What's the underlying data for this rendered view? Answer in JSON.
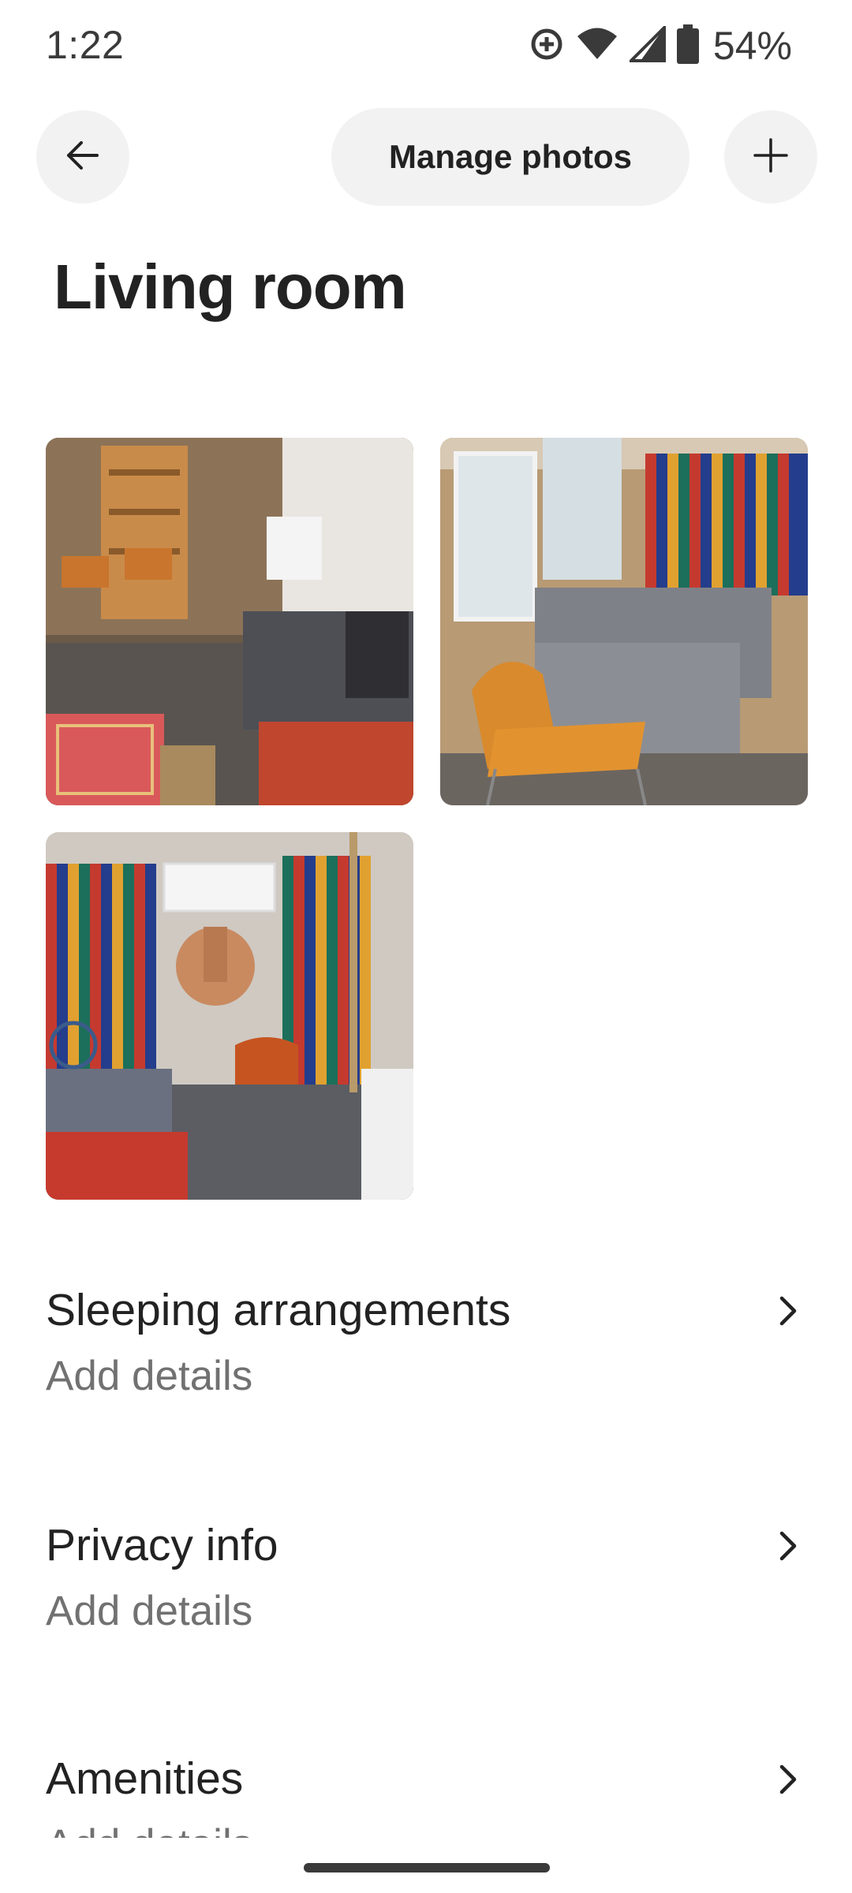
{
  "status_bar": {
    "time": "1:22",
    "battery": "54%",
    "icons": [
      "data-saver-icon",
      "wifi-icon",
      "signal-icon",
      "battery-icon"
    ]
  },
  "top_bar": {
    "back_icon": "arrow-left-icon",
    "manage_label": "Manage photos",
    "add_icon": "plus-icon"
  },
  "page": {
    "title": "Living room"
  },
  "photos": [
    {
      "description_icon": "living-room-photo"
    },
    {
      "description_icon": "living-room-photo"
    },
    {
      "description_icon": "living-room-photo"
    }
  ],
  "sections": [
    {
      "title": "Sleeping arrangements",
      "subtitle": "Add details"
    },
    {
      "title": "Privacy info",
      "subtitle": "Add details"
    },
    {
      "title": "Amenities",
      "subtitle": "Add details"
    }
  ],
  "colors": {
    "text_primary": "#222222",
    "text_secondary": "#717171",
    "button_bg": "#f2f2f2"
  }
}
